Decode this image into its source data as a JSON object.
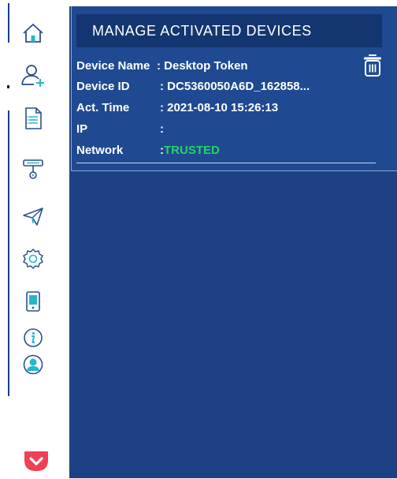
{
  "sidebar": {
    "icons": [
      {
        "name": "home-icon"
      },
      {
        "name": "add-user-icon"
      },
      {
        "name": "document-icon"
      },
      {
        "name": "token-key-icon"
      },
      {
        "name": "send-icon"
      },
      {
        "name": "settings-icon"
      },
      {
        "name": "mobile-device-icon"
      },
      {
        "name": "info-icon"
      },
      {
        "name": "user-profile-icon"
      }
    ],
    "footer_icon": "pocket-icon"
  },
  "panel": {
    "title": "MANAGE ACTIVATED DEVICES",
    "device": {
      "name_label": "Device  Name",
      "name_value": ": Desktop Token",
      "id_label": "Device ID",
      "id_value": ": DC5360050A6D_162858...",
      "time_label": "Act. Time",
      "time_value": ": 2021-08-10 15:26:13",
      "ip_label": "IP",
      "ip_value": ":",
      "network_label": "Network",
      "network_sep": ":",
      "network_value": "TRUSTED"
    },
    "delete_icon": "trash-icon"
  },
  "colors": {
    "panel_bg": "#1c4184",
    "title_bg": "#133671",
    "trusted": "#25d366",
    "icon_stroke": "#2a4f8f",
    "icon_accent": "#22b8c8",
    "pocket": "#ef4056"
  }
}
